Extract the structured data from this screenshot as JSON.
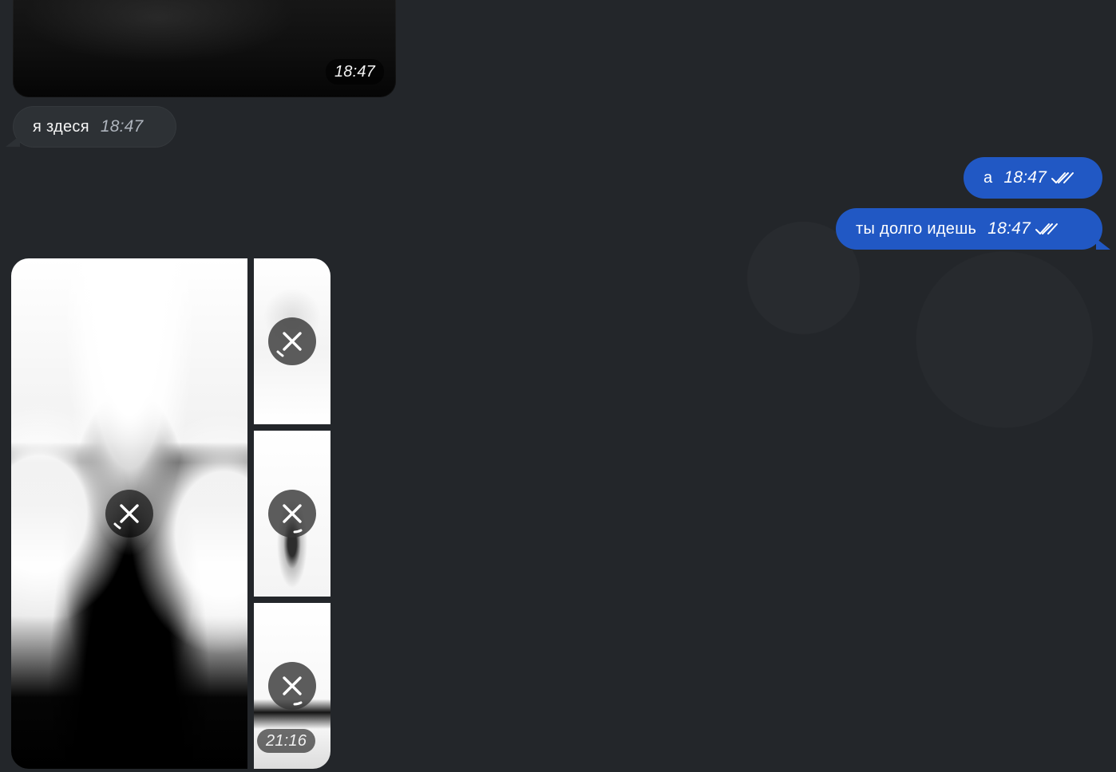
{
  "messages": {
    "media_top": {
      "time": "18:47"
    },
    "incoming_1": {
      "text": "я здеся",
      "time": "18:47"
    },
    "outgoing_1": {
      "text": "а",
      "time": "18:47",
      "status_icon": "double-check-icon"
    },
    "outgoing_2": {
      "text": "ты долго идешь",
      "time": "18:47",
      "status_icon": "double-check-icon"
    },
    "media_album": {
      "time": "21:16",
      "items": [
        {
          "status_icon": "close-icon"
        },
        {
          "status_icon": "close-icon"
        },
        {
          "status_icon": "close-icon"
        },
        {
          "status_icon": "close-icon"
        }
      ]
    }
  },
  "colors": {
    "background": "#23262a",
    "incoming_bubble": "#2d3135",
    "outgoing_bubble": "#2158c4",
    "time_text": "#aeb4bd"
  }
}
